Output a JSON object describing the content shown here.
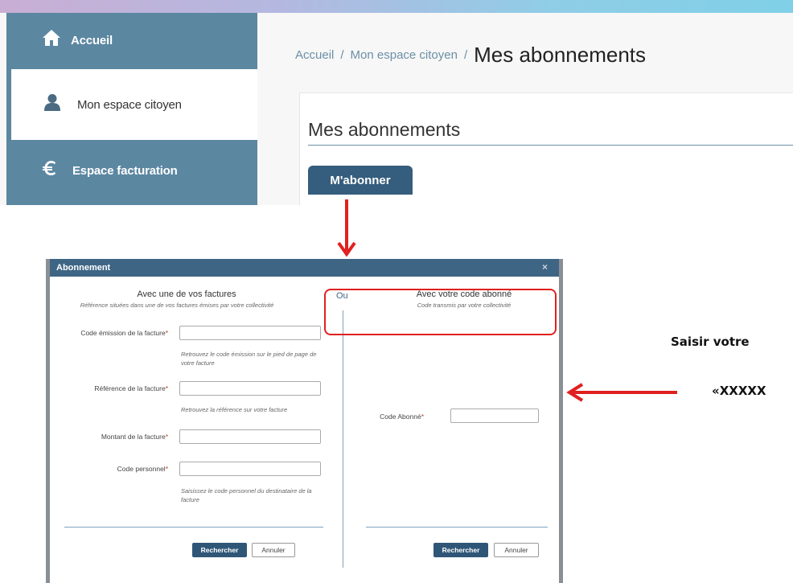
{
  "sidebar": {
    "items": [
      {
        "label": "Accueil",
        "icon": "home-icon"
      },
      {
        "label": "Mon espace citoyen",
        "icon": "user-icon"
      },
      {
        "label": "Espace facturation",
        "icon": "euro-icon"
      }
    ]
  },
  "breadcrumb": {
    "items": [
      "Accueil",
      "Mon espace citoyen"
    ],
    "separator": "/",
    "current": "Mes abonnements"
  },
  "main": {
    "section_title": "Mes abonnements",
    "subscribe_button": "M'abonner"
  },
  "modal": {
    "title": "Abonnement",
    "close_symbol": "×",
    "or_label": "Ou",
    "left": {
      "title": "Avec une de vos factures",
      "subtitle": "Référence situées dans une de vos factures émises par votre collectivité",
      "fields": [
        {
          "label": "Code émission de la facture",
          "help": "Retrouvez le code émission sur le pied de page de votre facture"
        },
        {
          "label": "Référence de la facture",
          "help": "Retrouvez la référence sur votre facture"
        },
        {
          "label": "Montant de la facture",
          "help": ""
        },
        {
          "label": "Code personnel",
          "help": "Saisissez le code personnel du destinataire de la facture"
        }
      ],
      "search_button": "Rechercher",
      "cancel_button": "Annuler"
    },
    "right": {
      "title": "Avec votre code abonné",
      "subtitle": "Code transmis par votre collectivité",
      "field_label": "Code Abonné",
      "search_button": "Rechercher",
      "cancel_button": "Annuler"
    },
    "required_mark": "*"
  },
  "annotation": {
    "line1": "Saisir votre",
    "line2": "«XXXXX"
  },
  "colors": {
    "sidebar": "#5b87a1",
    "primary_button": "#355d7d",
    "modal_header": "#3f6584",
    "highlight": "#e02020"
  }
}
